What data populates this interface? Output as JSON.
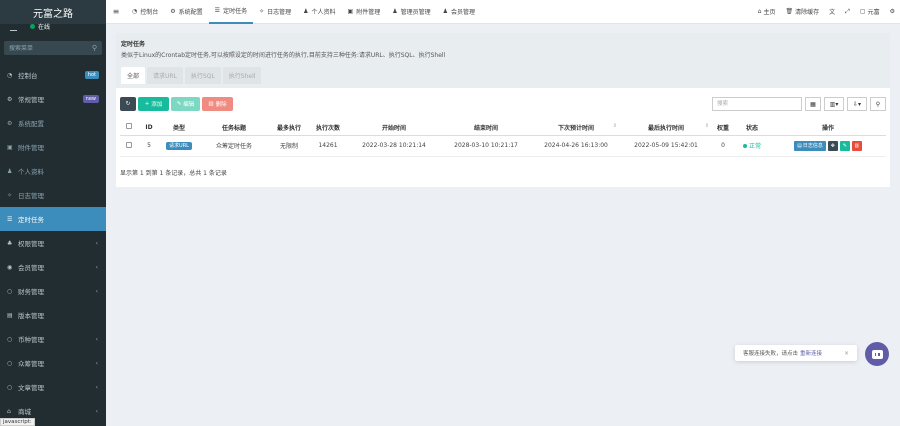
{
  "sidebar": {
    "title": "元富之路",
    "status": "在线",
    "search_placeholder": "搜索菜单",
    "items": [
      {
        "label": "控制台",
        "icon": "dashboard-icon",
        "badge": "hot"
      },
      {
        "label": "常规管理",
        "icon": "cogs-icon",
        "badge": "new"
      },
      {
        "label": "系统配置",
        "icon": "cog-icon"
      },
      {
        "label": "附件管理",
        "icon": "file-image-icon"
      },
      {
        "label": "个人资料",
        "icon": "user-icon"
      },
      {
        "label": "日志管理",
        "icon": "magic-icon"
      },
      {
        "label": "定时任务",
        "icon": "tasks-icon"
      },
      {
        "label": "权限管理",
        "icon": "group-icon"
      },
      {
        "label": "会员管理",
        "icon": "user-circle-icon"
      },
      {
        "label": "财务管理",
        "icon": "circle-icon"
      },
      {
        "label": "版本管理",
        "icon": "file-text-icon"
      },
      {
        "label": "币种管理",
        "icon": "circle-icon"
      },
      {
        "label": "众筹管理",
        "icon": "circle-icon"
      },
      {
        "label": "文章管理",
        "icon": "circle-icon"
      },
      {
        "label": "商城",
        "icon": "home-icon"
      }
    ]
  },
  "topnav": {
    "tabs": [
      {
        "label": "控制台",
        "icon": "dashboard-icon"
      },
      {
        "label": "系统配置",
        "icon": "cog-icon"
      },
      {
        "label": "定时任务",
        "icon": "tasks-icon"
      },
      {
        "label": "日志管理",
        "icon": "magic-icon"
      },
      {
        "label": "个人资料",
        "icon": "user-icon"
      },
      {
        "label": "附件管理",
        "icon": "file-image-icon"
      },
      {
        "label": "管理员管理",
        "icon": "user-icon"
      },
      {
        "label": "会员管理",
        "icon": "user-icon"
      }
    ],
    "right": {
      "home": "主页",
      "clear_cache": "清除缓存",
      "admin": "元富"
    }
  },
  "panel": {
    "title": "定时任务",
    "description": "类似于Linux的Crontab定时任务,可以按照设定的时间进行任务的执行,目前支持三种任务:请求URL、执行SQL、执行Shell",
    "subtabs": [
      "全部",
      "请求URL",
      "执行SQL",
      "执行Shell"
    ]
  },
  "toolbar": {
    "add": "添加",
    "edit": "编辑",
    "delete": "删除",
    "search_placeholder": "搜索"
  },
  "table": {
    "headers": [
      "ID",
      "类型",
      "任务标题",
      "最多执行",
      "执行次数",
      "开始时间",
      "结束时间",
      "下次预计时间",
      "最后执行时间",
      "权重",
      "状态",
      "操作"
    ],
    "rows": [
      {
        "id": "5",
        "type": "请求URL",
        "title": "众筹定时任务",
        "max_exec": "无限制",
        "exec_count": "14261",
        "start": "2022-03-28 10:21:14",
        "end": "2028-03-10 10:21:17",
        "next": "2024-04-26 16:13:00",
        "last": "2022-05-09 15:42:01",
        "weight": "0",
        "status": "正常",
        "log_btn": "日志信息"
      }
    ],
    "pager": "显示第 1 到第 1 条记录，总共 1 条记录"
  },
  "toast": {
    "text": "客服连接失败，请点击",
    "link": "重新连接"
  },
  "statusbar": "javascript:",
  "colors": {
    "sidebar_bg": "#222d32",
    "active_blue": "#3c8dbc",
    "success": "#18bc9c",
    "danger": "#e74c3c",
    "purple": "#605ca8"
  }
}
